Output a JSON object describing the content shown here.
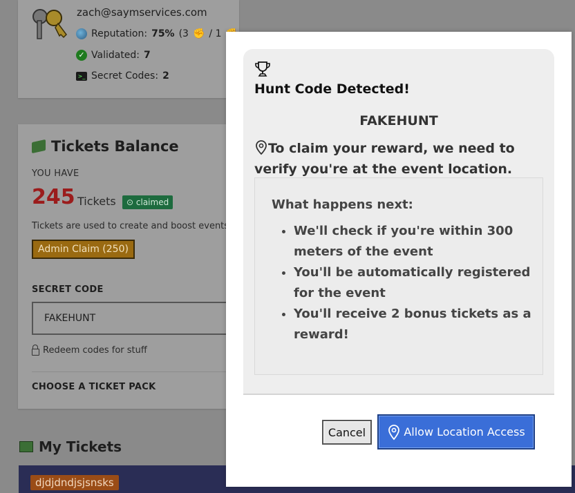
{
  "profile": {
    "email": "zach@saymservices.com",
    "reputation_label": "Reputation:",
    "reputation_value": "75%",
    "reputation_detail": "(3",
    "reputation_sep": "/ 1",
    "validated_label": "Validated:",
    "validated_value": "7",
    "secret_codes_label": "Secret Codes:",
    "secret_codes_value": "2"
  },
  "balance": {
    "title": "Tickets Balance",
    "you_have": "YOU HAVE",
    "count": "245",
    "unit": "Tickets",
    "badge": "claimed",
    "description": "Tickets are used to create and boost events, ar",
    "admin_claim": "Admin Claim (250)",
    "secret_code_label": "SECRET CODE",
    "secret_code_value": "FAKEHUNT",
    "redeem_text": "Redeem codes for stuff",
    "choose_pack": "CHOOSE A TICKET PACK"
  },
  "my_tickets": {
    "title": "My Tickets",
    "first_tag": "djdjdndjsjsnsks"
  },
  "modal": {
    "title": "Hunt Code Detected!",
    "hunt_code": "FAKEHUNT",
    "verify_message": "To claim your reward, we need to verify you're at the event location.",
    "next_title": "What happens next:",
    "next_items": [
      "We'll check if you're within 300 meters of the event",
      "You'll be automatically registered for the event",
      "You'll receive 2 bonus tickets as a reward!"
    ],
    "cancel_label": "Cancel",
    "allow_label": "Allow Location Access"
  },
  "colors": {
    "accent": "#3a6ed8",
    "ticket_count": "#9b1c1c",
    "badge": "#1d6b3e"
  },
  "icons": [
    "keys-icon",
    "globe-icon",
    "check-icon",
    "terminal-icon",
    "money-icon",
    "lock-icon",
    "tickets-stack-icon",
    "trophy-icon",
    "location-pin-icon"
  ]
}
